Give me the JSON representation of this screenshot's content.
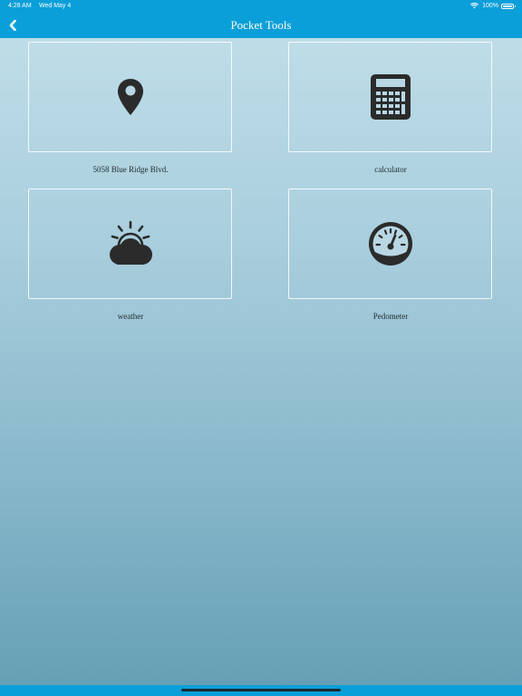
{
  "status_bar": {
    "time": "4:28 AM",
    "date": "Wed May 4",
    "battery": "100%"
  },
  "nav": {
    "title": "Pocket Tools",
    "back_icon": "chevron-left-icon"
  },
  "tiles": [
    {
      "label": "5058 Blue Ridge Blvd.",
      "icon": "map-pin-icon"
    },
    {
      "label": "calculator",
      "icon": "calculator-icon"
    },
    {
      "label": "weather",
      "icon": "partly-cloudy-icon"
    },
    {
      "label": "Pedometer",
      "icon": "speedometer-icon"
    }
  ],
  "colors": {
    "accent": "#0a9fd9",
    "icon": "#2b2b2b",
    "background_top": "#c2dfe9",
    "background_bottom": "#649eb4"
  }
}
